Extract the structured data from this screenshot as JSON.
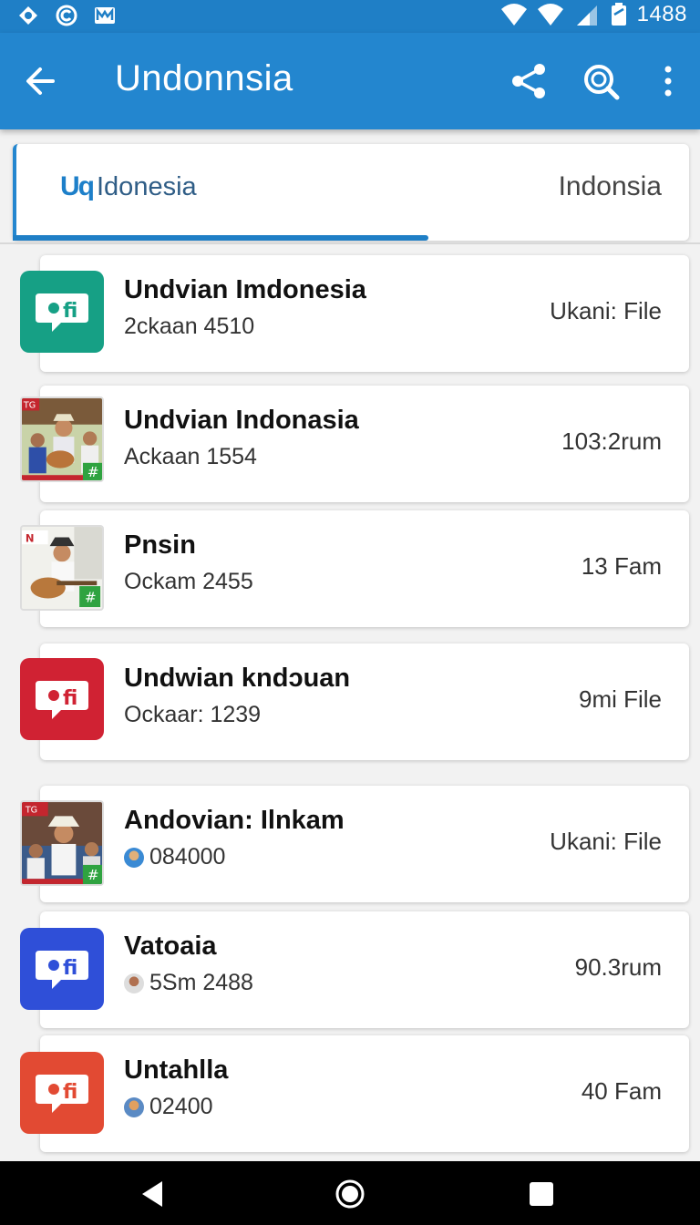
{
  "status_bar": {
    "time": "1488",
    "left_icons": [
      "location-icon",
      "copyright-icon",
      "mail-icon"
    ],
    "right_icons": [
      "wifi-icon",
      "signal-icon",
      "battery-icon"
    ]
  },
  "app_bar": {
    "title": "Undonnsia",
    "actions": [
      "back-arrow-icon",
      "share-icon",
      "search-icon",
      "more-vert-icon"
    ],
    "color": "#2386cf"
  },
  "tabs": {
    "logo_text": "Uq",
    "left_label": "Idonesia",
    "right_label": "Indonsia",
    "indicator_color": "#1f7fc6"
  },
  "items": [
    {
      "name": "Undvian Imdonesia",
      "sub": "2ckaan 4510",
      "meta": "Ukani: File",
      "icon": "chat-icon",
      "color": "#16a085"
    },
    {
      "name": "Undvian Indonasia",
      "sub": "Ackaan 1554",
      "meta": "103:2rum",
      "icon": "photo-thumbnail",
      "badge": "#"
    },
    {
      "name": "Pnsin",
      "sub": "Ockam 2455",
      "meta": "13 Fam",
      "icon": "photo-thumbnail",
      "badge": "#"
    },
    {
      "name": "Undwian kndɔuan",
      "sub": "Ockaar: 1239",
      "meta": "9mi File",
      "icon": "chat-icon",
      "color": "#d02233"
    },
    {
      "name": "Andovian: Ilnkam",
      "sub": "084000",
      "meta": "Ukani: File",
      "icon": "photo-thumbnail",
      "badge": "#"
    },
    {
      "name": "Vatoaia",
      "sub": "5Sm 2488",
      "meta": "90.3rum",
      "icon": "chat-icon",
      "color": "#2f4fd8"
    },
    {
      "name": "Untahlla",
      "sub": "02400",
      "meta": "40 Fam",
      "icon": "chat-icon",
      "color": "#e24a33"
    }
  ],
  "nav_bar": {
    "buttons": [
      "back-triangle-icon",
      "home-circle-icon",
      "recents-square-icon"
    ]
  }
}
